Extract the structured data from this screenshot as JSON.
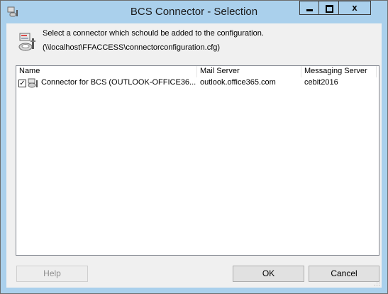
{
  "window": {
    "title": "BCS Connector - Selection",
    "close_glyph": "x",
    "title_bar_color": "#aad0ec"
  },
  "info": {
    "line1": "Select a connector which schould be added to the configuration.",
    "line2": "(\\\\localhost\\FFACCESS\\connectorconfiguration.cfg)",
    "icon": "connector-config-icon"
  },
  "list": {
    "columns": [
      "Name",
      "Mail Server",
      "Messaging Server"
    ],
    "rows": [
      {
        "checked": true,
        "name": "Connector for BCS (OUTLOOK-OFFICE36...",
        "mail_server": "outlook.office365.com",
        "messaging_server": "cebit2016",
        "icon": "connector-icon"
      }
    ]
  },
  "buttons": {
    "help": "Help",
    "ok": "OK",
    "cancel": "Cancel"
  }
}
